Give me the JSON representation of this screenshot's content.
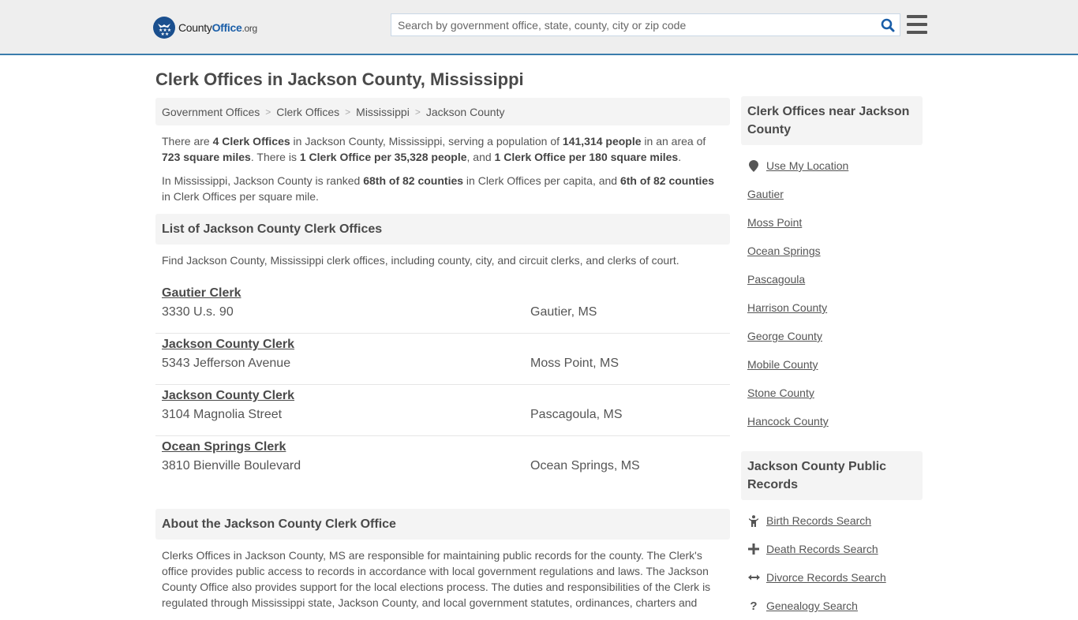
{
  "header": {
    "logo": {
      "name": "County",
      "highlight": "Office",
      "suffix": ".org",
      "brand_color": "#1a4f8e"
    },
    "search": {
      "placeholder": "Search by government office, state, county, city or zip code",
      "value": ""
    },
    "accent_color": "#3a7cac"
  },
  "page": {
    "title": "Clerk Offices in Jackson County, Mississippi"
  },
  "breadcrumb": [
    {
      "label": "Government Offices"
    },
    {
      "label": "Clerk Offices"
    },
    {
      "label": "Mississippi"
    },
    {
      "label": "Jackson County"
    }
  ],
  "intro": {
    "p1": {
      "t1": "There are ",
      "b1": "4 Clerk Offices",
      "t2": " in Jackson County, Mississippi, serving a population of ",
      "b2": "141,314 people",
      "t3": " in an area of ",
      "b3": "723 square miles",
      "t4": ". There is ",
      "b4": "1 Clerk Office per 35,328 people",
      "t5": ", and ",
      "b5": "1 Clerk Office per 180 square miles",
      "t6": "."
    },
    "p2": {
      "t1": "In Mississippi, Jackson County is ranked ",
      "b1": "68th of 82 counties",
      "t2": " in Clerk Offices per capita, and ",
      "b2": "6th of 82 counties",
      "t3": " in Clerk Offices per square mile."
    }
  },
  "list_section": {
    "title": "List of Jackson County Clerk Offices",
    "description": "Find Jackson County, Mississippi clerk offices, including county, city, and circuit clerks, and clerks of court.",
    "offices": [
      {
        "name": "Gautier Clerk",
        "address": "3330 U.s. 90",
        "city": "Gautier, MS"
      },
      {
        "name": "Jackson County Clerk",
        "address": "5343 Jefferson Avenue",
        "city": "Moss Point, MS"
      },
      {
        "name": "Jackson County Clerk",
        "address": "3104 Magnolia Street",
        "city": "Pascagoula, MS"
      },
      {
        "name": "Ocean Springs Clerk",
        "address": "3810 Bienville Boulevard",
        "city": "Ocean Springs, MS"
      }
    ]
  },
  "about_section": {
    "title": "About the Jackson County Clerk Office",
    "text": "Clerks Offices in Jackson County, MS are responsible for maintaining public records for the county. The Clerk's office provides public access to records in accordance with local government regulations and laws. The Jackson County Office also provides support for the local elections process. The duties and responsibilities of the Clerk is regulated through Mississippi state, Jackson County, and local government statutes, ordinances, charters and"
  },
  "sidebar": {
    "nearby": {
      "title": "Clerk Offices near Jackson County",
      "use_location": {
        "label": "Use My Location",
        "icon": "map-marker-icon"
      },
      "links": [
        {
          "label": "Gautier"
        },
        {
          "label": "Moss Point"
        },
        {
          "label": "Ocean Springs"
        },
        {
          "label": "Pascagoula"
        },
        {
          "label": "Harrison County"
        },
        {
          "label": "George County"
        },
        {
          "label": "Mobile County"
        },
        {
          "label": "Stone County"
        },
        {
          "label": "Hancock County"
        }
      ]
    },
    "records": {
      "title": "Jackson County Public Records",
      "links": [
        {
          "label": "Birth Records Search",
          "icon": "child-icon",
          "glyph": "Ὣ8"
        },
        {
          "label": "Death Records Search",
          "icon": "plus-icon",
          "glyph": "✚"
        },
        {
          "label": "Divorce Records Search",
          "icon": "arrows-horizontal-icon",
          "glyph": "↔"
        },
        {
          "label": "Genealogy Search",
          "icon": "question-icon",
          "glyph": "?"
        }
      ]
    }
  }
}
